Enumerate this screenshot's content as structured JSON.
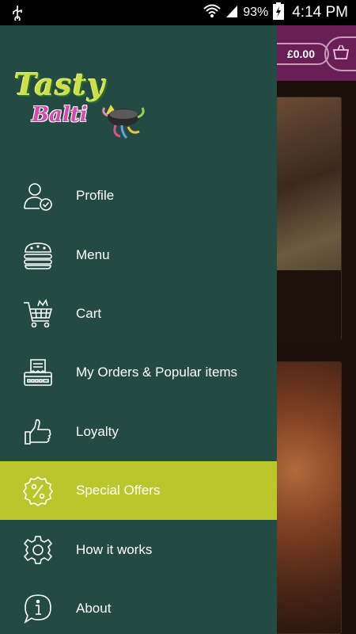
{
  "status_bar": {
    "battery_percent": "93%",
    "time": "4:14 PM"
  },
  "background": {
    "cart_total": "£0.00"
  },
  "drawer": {
    "logo": {
      "line1": "Tasty",
      "line2": "Balti"
    },
    "items": [
      {
        "label": "Profile",
        "icon": "profile-icon",
        "active": false
      },
      {
        "label": "Menu",
        "icon": "menu-burger-icon",
        "active": false
      },
      {
        "label": "Cart",
        "icon": "cart-icon",
        "active": false
      },
      {
        "label": "My Orders & Popular items",
        "icon": "orders-icon",
        "active": false
      },
      {
        "label": "Loyalty",
        "icon": "thumbs-up-icon",
        "active": false
      },
      {
        "label": "Special Offers",
        "icon": "percent-badge-icon",
        "active": true
      },
      {
        "label": "How it works",
        "icon": "gear-icon",
        "active": false
      },
      {
        "label": "About",
        "icon": "info-icon",
        "active": false
      }
    ],
    "colors": {
      "drawer_bg": "#234b43",
      "active_bg": "#b9c72d",
      "header_bg": "#6a1e56"
    }
  }
}
